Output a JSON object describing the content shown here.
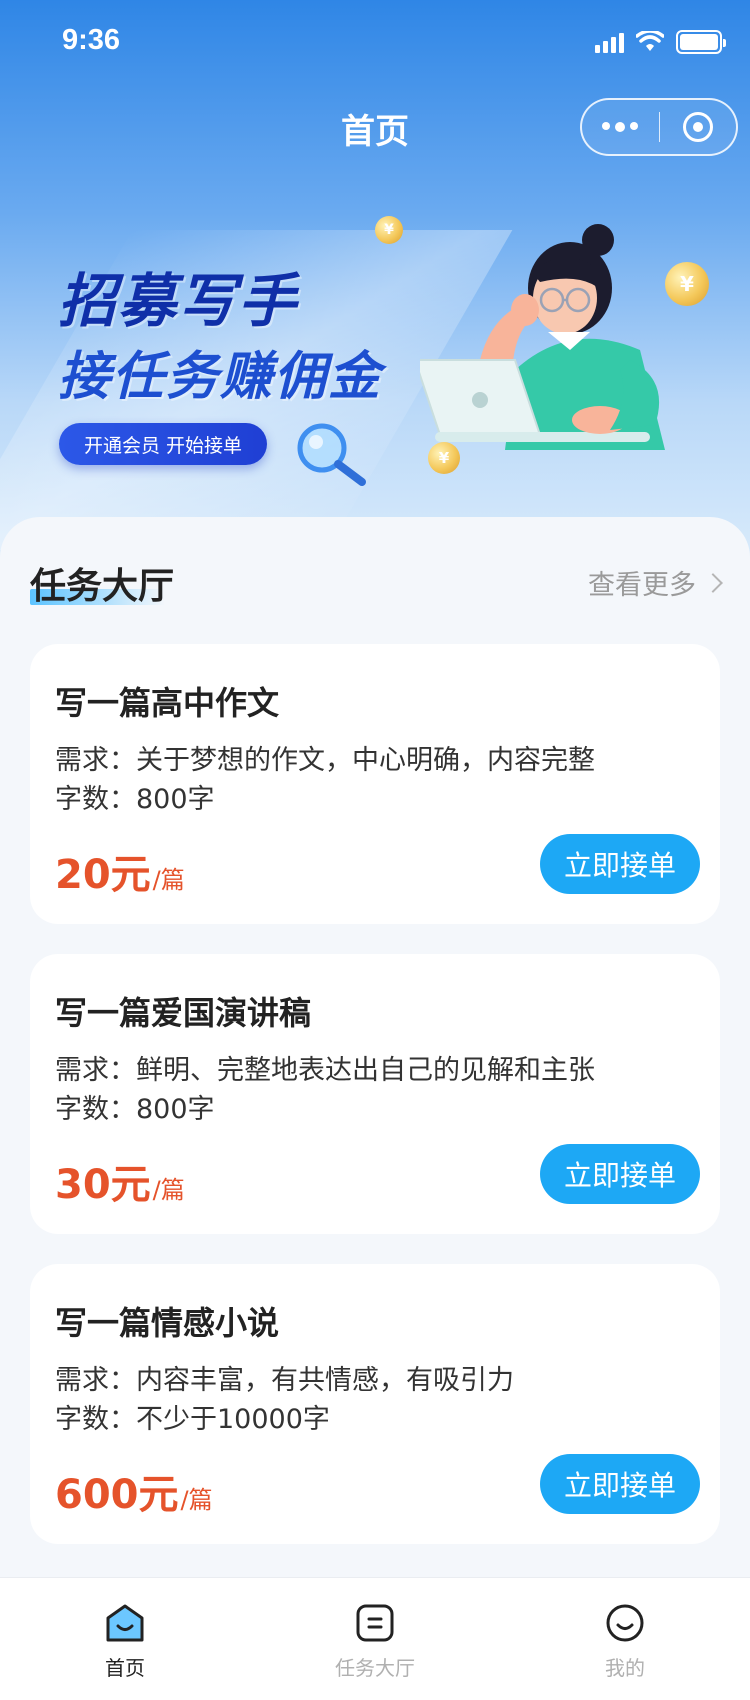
{
  "status_bar": {
    "time": "9:36"
  },
  "nav": {
    "title": "首页"
  },
  "banner": {
    "line1": "招募写手",
    "line2": "接任务赚佣金",
    "pill": "开通会员 开始接单"
  },
  "section": {
    "title": "任务大厅",
    "see_more": "查看更多"
  },
  "tasks": [
    {
      "title": "写一篇高中作文",
      "requirement": "需求：关于梦想的作文，中心明确，内容完整",
      "words": "字数：800字",
      "price": "20元",
      "unit": "/篇",
      "button": "立即接单"
    },
    {
      "title": "写一篇爱国演讲稿",
      "requirement": "需求：鲜明、完整地表达出自己的见解和主张",
      "words": "字数：800字",
      "price": "30元",
      "unit": "/篇",
      "button": "立即接单"
    },
    {
      "title": "写一篇情感小说",
      "requirement": "需求：内容丰富，有共情感，有吸引力",
      "words": "字数：不少于10000字",
      "price": "600元",
      "unit": "/篇",
      "button": "立即接单"
    }
  ],
  "tabbar": {
    "items": [
      {
        "label": "首页",
        "icon": "home-icon",
        "active": true
      },
      {
        "label": "任务大厅",
        "icon": "task-hall-icon",
        "active": false
      },
      {
        "label": "我的",
        "icon": "profile-icon",
        "active": false
      }
    ]
  },
  "colors": {
    "accent": "#1da8f5",
    "price": "#e5532b",
    "banner_text": "#0f2fa8"
  }
}
